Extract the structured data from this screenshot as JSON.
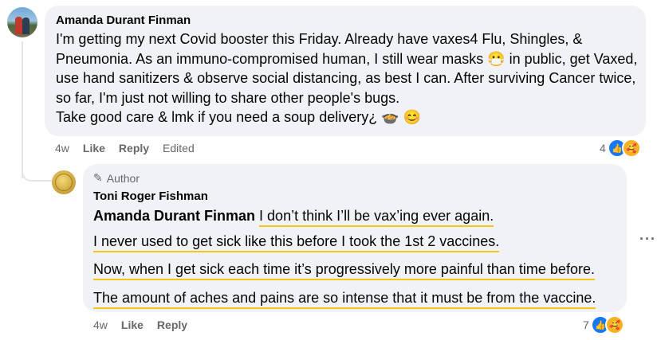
{
  "comment1": {
    "author": "Amanda Durant Finman",
    "paragraphs": [
      "I'm getting my next Covid booster this Friday. Already have vaxes4 Flu, Shingles, & Pneumonia. As an immuno-compromised human, I still wear masks 😷 in public, get Vaxed, use hand sanitizers & observe social distancing, as best I can. After surviving Cancer twice, so far, I'm just not willing to share other people's bugs.",
      "Take good care & lmk if you need a soup delivery¿ 🍲 😊"
    ],
    "time": "4w",
    "like_label": "Like",
    "reply_label": "Reply",
    "edited_label": "Edited",
    "reaction_count": "4",
    "reactions": [
      "like-icon",
      "care-icon"
    ]
  },
  "comment2": {
    "badge": "Author",
    "author": "Toni Roger Fishman",
    "mention": "Amanda Durant Finman",
    "lines": [
      "I don’t think I’ll be vax’ing ever again.",
      "I never used to get sick like this before I took the 1st 2 vaccines.",
      "Now, when I get sick each time it’s progressively more painful than time before.",
      "The amount of aches and pains are so intense that it must be from the vaccine."
    ],
    "time": "4w",
    "like_label": "Like",
    "reply_label": "Reply",
    "reaction_count": "7",
    "reactions": [
      "like-icon",
      "care-icon"
    ]
  },
  "more_label": "···",
  "colors": {
    "highlight": "#f5c518",
    "bubble": "#f0f2f5",
    "like_blue": "#1877f2",
    "meta_gray": "#65676b"
  }
}
